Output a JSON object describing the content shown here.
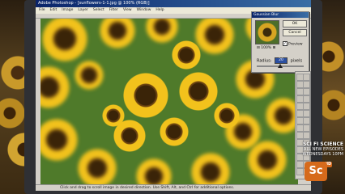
{
  "window": {
    "title": "Adobe Photoshop - [sunflowers-1-1.jpg @ 100% (RGB)]"
  },
  "menu": [
    "File",
    "Edit",
    "Image",
    "Layer",
    "Select",
    "Filter",
    "View",
    "Window",
    "Help"
  ],
  "dialog": {
    "title": "Gaussian Blur",
    "ok_label": "OK",
    "cancel_label": "Cancel",
    "preview_label": "Preview",
    "preview_checked": true,
    "zoom_text": "100%",
    "radius_label": "Radius:",
    "radius_value": "20",
    "radius_unit": "pixels",
    "radius_slider_fraction": 0.5
  },
  "status": {
    "text": "Click and drag to scroll image in desired direction. Use Shift, Alt, and Ctrl for additional options."
  },
  "overlay": {
    "promo_line1": "SCI FI SCIENCE",
    "promo_line2": "ALL NEW EPISODES",
    "promo_line3": "WEDNESDAYS 10PM",
    "logo": "Sc",
    "hd": "HD"
  },
  "colors": {
    "accent": "#d66a1b",
    "titlebar": "#0a246a"
  }
}
